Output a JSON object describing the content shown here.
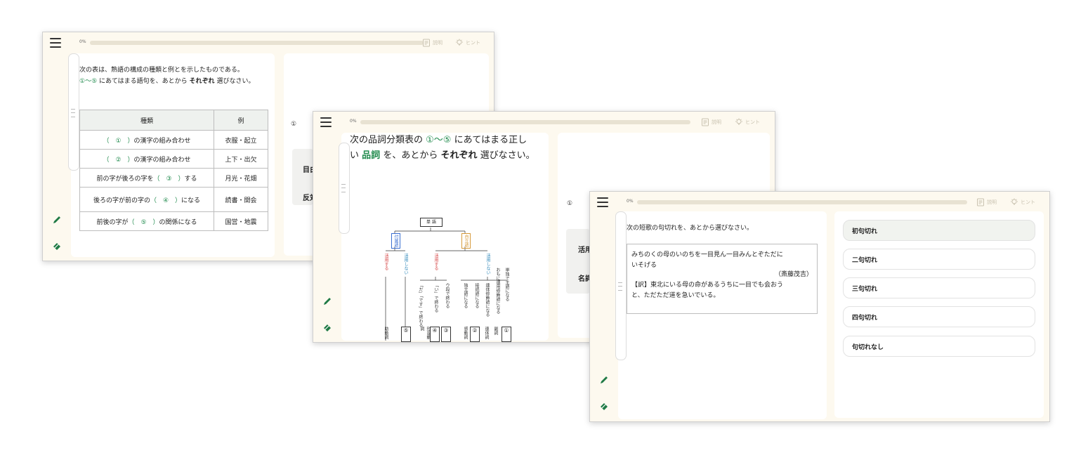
{
  "common": {
    "progress": "0%",
    "explain_label": "説明",
    "hint_label": "ヒント",
    "icons": [
      "menu-icon",
      "pencil-icon",
      "eraser-icon",
      "document-icon",
      "lightbulb-icon"
    ],
    "accent_color": "#1f8a4c"
  },
  "window1": {
    "prompt_line1": "次の表は、熟語の構成の種類と例とを示したものである。",
    "prompt_range": "①～⑤",
    "prompt_mid": "にあてはまる語句を、あとから",
    "prompt_bold": "それぞれ",
    "prompt_end": "選びなさい。",
    "table_headers": [
      "種類",
      "例"
    ],
    "rows": [
      {
        "pre": "",
        "marker": "（　①　）",
        "post": "の漢字の組み合わせ",
        "example": "衣服・起立"
      },
      {
        "pre": "",
        "marker": "（　②　）",
        "post": "の漢字の組み合わせ",
        "example": "上下・出欠"
      },
      {
        "pre": "前の字が後ろの字を",
        "marker": "（　③　）",
        "post": "する",
        "example": "月光・花畑"
      },
      {
        "pre": "後ろの字が前の字の",
        "marker": "（　④　）",
        "post": "になる",
        "example": "読書・開会"
      },
      {
        "pre": "前後の字が",
        "marker": "（　⑤　）",
        "post": "の関係になる",
        "example": "国営・地震"
      }
    ]
  },
  "window2": {
    "prompt_a": "次の品詞分類表の",
    "prompt_range": "①～⑤",
    "prompt_b": "にあてはまる正し",
    "prompt_c": "い",
    "prompt_green_bold": "品詞",
    "prompt_d": "を、あとから",
    "prompt_bold": "それぞれ",
    "prompt_e": "選びなさい。",
    "tree": {
      "root": "単 語",
      "fuzokugo": "付属語",
      "jiritsugo": "自立語",
      "katsuyou_suru": "活用する",
      "katsuyou_shinai": "活用しない",
      "katsuyou_suru2": "活用する",
      "katsuyou_shinai2": "活用しない",
      "leaf_jodoushi": "助動詞",
      "leaf5": "⑤",
      "cond_da": "「だ」「です」で終わる",
      "cond_i": "「い」で終わる",
      "cond_u": "ウ段で終わる",
      "leaf_keiyoudoushi": "形容動詞",
      "leaf4": "④",
      "leaf3": "③",
      "cond_dokuritsu": "独立語になる",
      "cond_setsuzoku": "接続語になる",
      "cond_rentai": "連体修飾語になる",
      "cond_shugo": "単独で主語になる",
      "cond_renyou": "おもに連用修飾語になる",
      "leaf_kandoushi": "感動詞",
      "leaf2": "②",
      "leaf_rentaishi": "連体詞",
      "leaf_fukushi": "副詞",
      "leaf1": "①"
    },
    "side_marker": "①",
    "side_label1": "目白",
    "side_label2": "反対"
  },
  "window3": {
    "prompt": "次の短歌の句切れを、あとから選びなさい。",
    "poem_line1": "みちのくの母のいのちを一目見ん一目みんとぞただに",
    "poem_line2": "いそげる",
    "author": "（斎藤茂吉）",
    "translation1": "【訳】東北にいる母の命があるうちに一目でも会おう",
    "translation2": "と、ただただ道を急いでいる。",
    "choices": [
      "初句切れ",
      "二句切れ",
      "三句切れ",
      "四句切れ",
      "句切れなし"
    ],
    "side_marker": "①",
    "side_label1": "活用",
    "side_label2": "名詞"
  }
}
